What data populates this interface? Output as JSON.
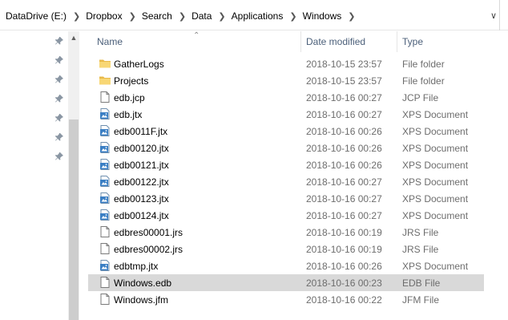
{
  "breadcrumb": [
    "DataDrive (E:)",
    "Dropbox",
    "Search",
    "Data",
    "Applications",
    "Windows"
  ],
  "columns": {
    "name": "Name",
    "date": "Date modified",
    "type": "Type"
  },
  "files": [
    {
      "name": "GatherLogs",
      "date": "2018-10-15 23:57",
      "type": "File folder",
      "icon": "folder-icon",
      "selected": false
    },
    {
      "name": "Projects",
      "date": "2018-10-15 23:57",
      "type": "File folder",
      "icon": "folder-icon",
      "selected": false
    },
    {
      "name": "edb.jcp",
      "date": "2018-10-16 00:27",
      "type": "JCP File",
      "icon": "file-icon",
      "selected": false
    },
    {
      "name": "edb.jtx",
      "date": "2018-10-16 00:27",
      "type": "XPS Document",
      "icon": "xps-document-icon",
      "selected": false
    },
    {
      "name": "edb0011F.jtx",
      "date": "2018-10-16 00:26",
      "type": "XPS Document",
      "icon": "xps-document-icon",
      "selected": false
    },
    {
      "name": "edb00120.jtx",
      "date": "2018-10-16 00:26",
      "type": "XPS Document",
      "icon": "xps-document-icon",
      "selected": false
    },
    {
      "name": "edb00121.jtx",
      "date": "2018-10-16 00:26",
      "type": "XPS Document",
      "icon": "xps-document-icon",
      "selected": false
    },
    {
      "name": "edb00122.jtx",
      "date": "2018-10-16 00:27",
      "type": "XPS Document",
      "icon": "xps-document-icon",
      "selected": false
    },
    {
      "name": "edb00123.jtx",
      "date": "2018-10-16 00:27",
      "type": "XPS Document",
      "icon": "xps-document-icon",
      "selected": false
    },
    {
      "name": "edb00124.jtx",
      "date": "2018-10-16 00:27",
      "type": "XPS Document",
      "icon": "xps-document-icon",
      "selected": false
    },
    {
      "name": "edbres00001.jrs",
      "date": "2018-10-16 00:19",
      "type": "JRS File",
      "icon": "file-icon",
      "selected": false
    },
    {
      "name": "edbres00002.jrs",
      "date": "2018-10-16 00:19",
      "type": "JRS File",
      "icon": "file-icon",
      "selected": false
    },
    {
      "name": "edbtmp.jtx",
      "date": "2018-10-16 00:26",
      "type": "XPS Document",
      "icon": "xps-document-icon",
      "selected": false
    },
    {
      "name": "Windows.edb",
      "date": "2018-10-16 00:23",
      "type": "EDB File",
      "icon": "file-icon",
      "selected": true
    },
    {
      "name": "Windows.jfm",
      "date": "2018-10-16 00:22",
      "type": "JFM File",
      "icon": "file-icon",
      "selected": false
    }
  ],
  "colors": {
    "selected_row": "#d9d9d9",
    "header_text": "#4c607a",
    "folder": "#f8d775",
    "xps_blue": "#3b7fc4"
  }
}
